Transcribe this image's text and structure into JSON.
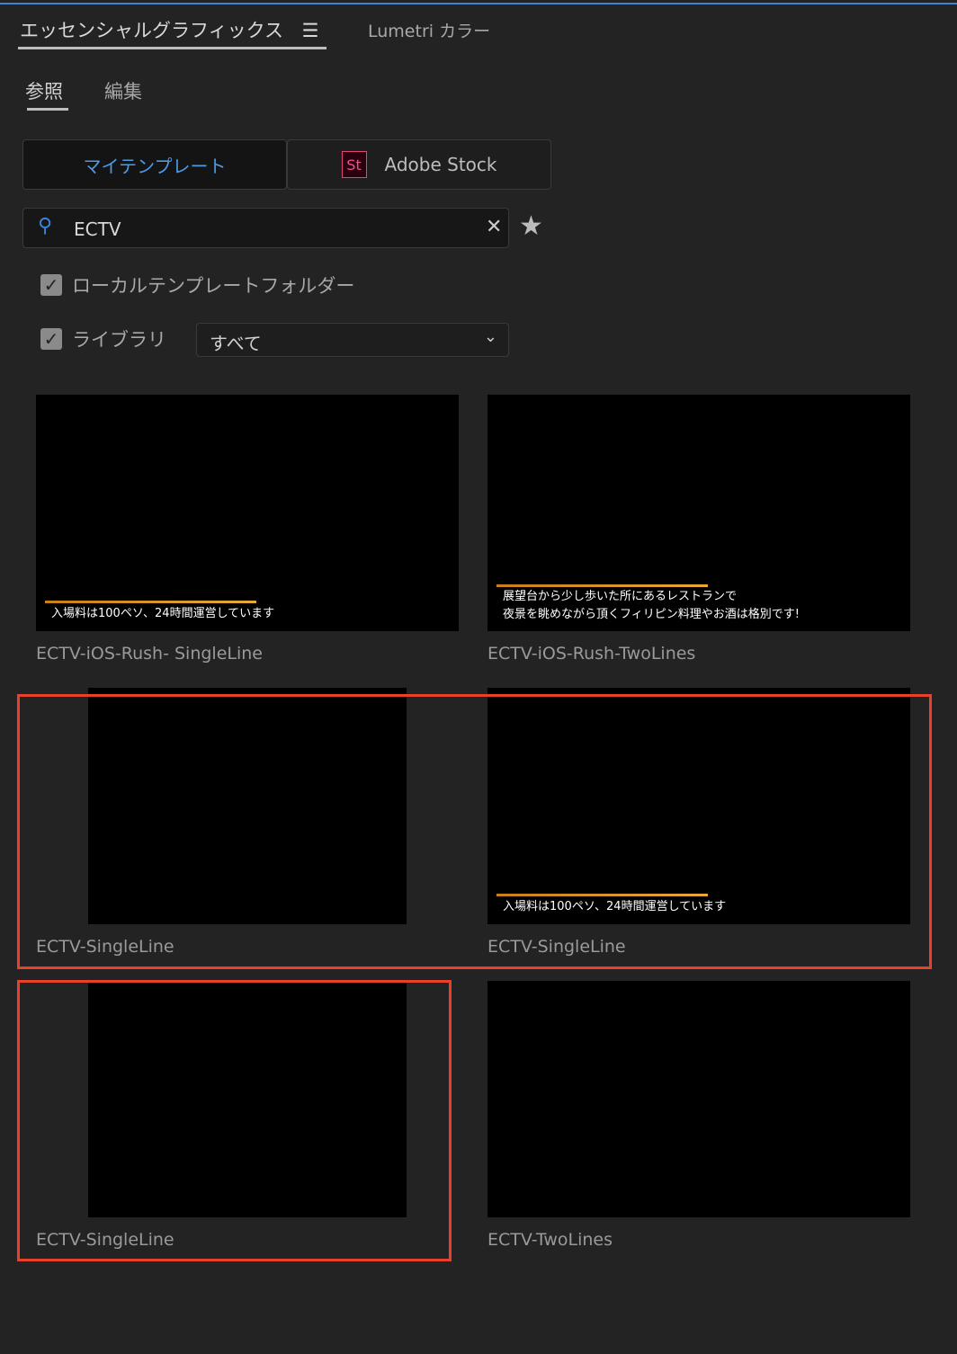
{
  "panel_tabs": [
    {
      "label": "エッセンシャルグラフィックス",
      "active": true
    },
    {
      "label": "Lumetri カラー",
      "active": false
    }
  ],
  "sub_tabs": [
    {
      "label": "参照",
      "active": true
    },
    {
      "label": "編集",
      "active": false
    }
  ],
  "source_buttons": {
    "my_templates": "マイテンプレート",
    "stock_icon": "St",
    "adobe_stock": "Adobe Stock"
  },
  "search": {
    "value": "ECTV"
  },
  "filters": {
    "local_folder": {
      "label": "ローカルテンプレートフォルダー",
      "checked": true
    },
    "library": {
      "label": "ライブラリ",
      "checked": true,
      "selected": "すべて"
    }
  },
  "accent_color": "#3d82d8",
  "highlight_color": "#e8402a",
  "templates": [
    {
      "name": "ECTV-iOS-Rush- SingleLine",
      "caption": [
        "入場料は100ペソ、24時間運営しています"
      ]
    },
    {
      "name": "ECTV-iOS-Rush-TwoLines",
      "caption": [
        "展望台から少し歩いた所にあるレストランで",
        "夜景を眺めながら頂くフィリピン料理やお酒は格別です!"
      ]
    },
    {
      "name": "ECTV-SingleLine",
      "caption": []
    },
    {
      "name": "ECTV-SingleLine",
      "caption": [
        "入場料は100ペソ、24時間運営しています"
      ]
    },
    {
      "name": "ECTV-SingleLine",
      "caption": []
    },
    {
      "name": "ECTV-TwoLines",
      "caption": []
    }
  ]
}
